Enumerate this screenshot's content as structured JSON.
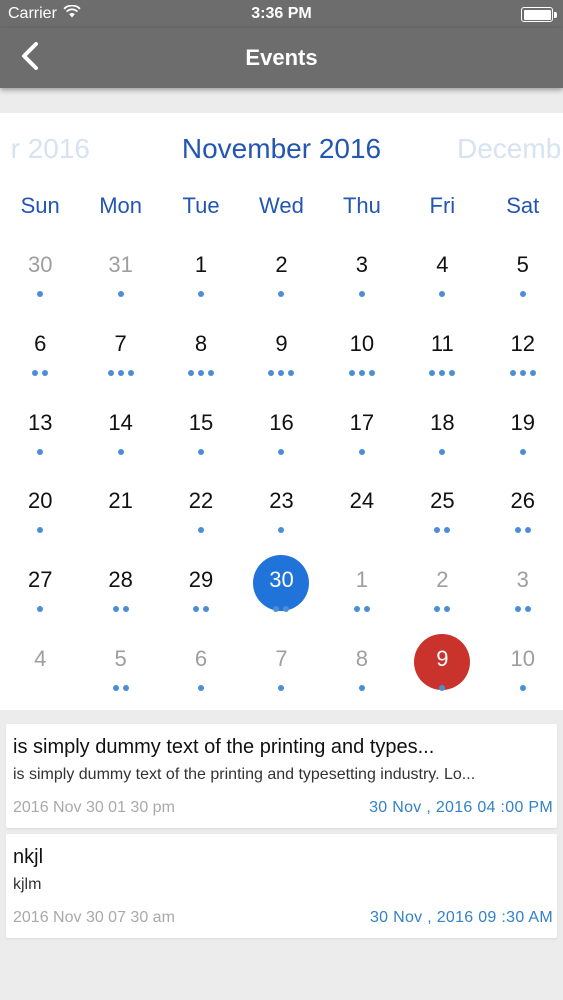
{
  "status_bar": {
    "carrier": "Carrier",
    "time": "3:36 PM"
  },
  "nav": {
    "title": "Events"
  },
  "calendar": {
    "prev_month": "r 2016",
    "current_month": "November 2016",
    "next_month": "Decemb",
    "weekdays": [
      "Sun",
      "Mon",
      "Tue",
      "Wed",
      "Thu",
      "Fri",
      "Sat"
    ],
    "weeks": [
      [
        {
          "day": "30",
          "muted": true,
          "dots": 1
        },
        {
          "day": "31",
          "muted": true,
          "dots": 1
        },
        {
          "day": "1",
          "dots": 1
        },
        {
          "day": "2",
          "dots": 1
        },
        {
          "day": "3",
          "dots": 1
        },
        {
          "day": "4",
          "dots": 1
        },
        {
          "day": "5",
          "dots": 1
        }
      ],
      [
        {
          "day": "6",
          "dots": 2
        },
        {
          "day": "7",
          "dots": 3
        },
        {
          "day": "8",
          "dots": 3
        },
        {
          "day": "9",
          "dots": 3
        },
        {
          "day": "10",
          "dots": 3
        },
        {
          "day": "11",
          "dots": 3
        },
        {
          "day": "12",
          "dots": 3
        }
      ],
      [
        {
          "day": "13",
          "dots": 1
        },
        {
          "day": "14",
          "dots": 1
        },
        {
          "day": "15",
          "dots": 1
        },
        {
          "day": "16",
          "dots": 1
        },
        {
          "day": "17",
          "dots": 1
        },
        {
          "day": "18",
          "dots": 1
        },
        {
          "day": "19",
          "dots": 1
        }
      ],
      [
        {
          "day": "20",
          "dots": 1
        },
        {
          "day": "21",
          "dots": 0
        },
        {
          "day": "22",
          "dots": 1
        },
        {
          "day": "23",
          "dots": 1
        },
        {
          "day": "24",
          "dots": 0
        },
        {
          "day": "25",
          "dots": 2
        },
        {
          "day": "26",
          "dots": 2
        }
      ],
      [
        {
          "day": "27",
          "dots": 1
        },
        {
          "day": "28",
          "dots": 2
        },
        {
          "day": "29",
          "dots": 2
        },
        {
          "day": "30",
          "dots": 2,
          "state": "selected"
        },
        {
          "day": "1",
          "muted": true,
          "dots": 2
        },
        {
          "day": "2",
          "muted": true,
          "dots": 2
        },
        {
          "day": "3",
          "muted": true,
          "dots": 2
        }
      ],
      [
        {
          "day": "4",
          "muted": true,
          "dots": 0
        },
        {
          "day": "5",
          "muted": true,
          "dots": 2
        },
        {
          "day": "6",
          "muted": true,
          "dots": 1
        },
        {
          "day": "7",
          "muted": true,
          "dots": 1
        },
        {
          "day": "8",
          "muted": true,
          "dots": 1
        },
        {
          "day": "9",
          "muted": true,
          "dots": 1,
          "state": "today"
        },
        {
          "day": "10",
          "muted": true,
          "dots": 1
        }
      ]
    ]
  },
  "events": [
    {
      "title": "is simply dummy text of the printing and types...",
      "description": "is simply dummy text of the printing and typesetting industry. Lo...",
      "created": "2016 Nov 30 01 30 pm",
      "event_time": "30  Nov , 2016  04 :00 PM"
    },
    {
      "title": "nkjl",
      "description": "kjlm",
      "created": "2016 Nov 30 07 30 am",
      "event_time": "30  Nov , 2016  09 :30 AM"
    }
  ],
  "colors": {
    "nav_bg": "#6d6d6d",
    "accent_blue": "#2356b2",
    "selected_day": "#1f73d9",
    "today_day": "#c9332c",
    "dot": "#4b8ed6",
    "event_time": "#3182c8"
  },
  "icons": {
    "back": "chevron-left-icon",
    "wifi": "wifi-icon",
    "battery": "battery-icon"
  }
}
